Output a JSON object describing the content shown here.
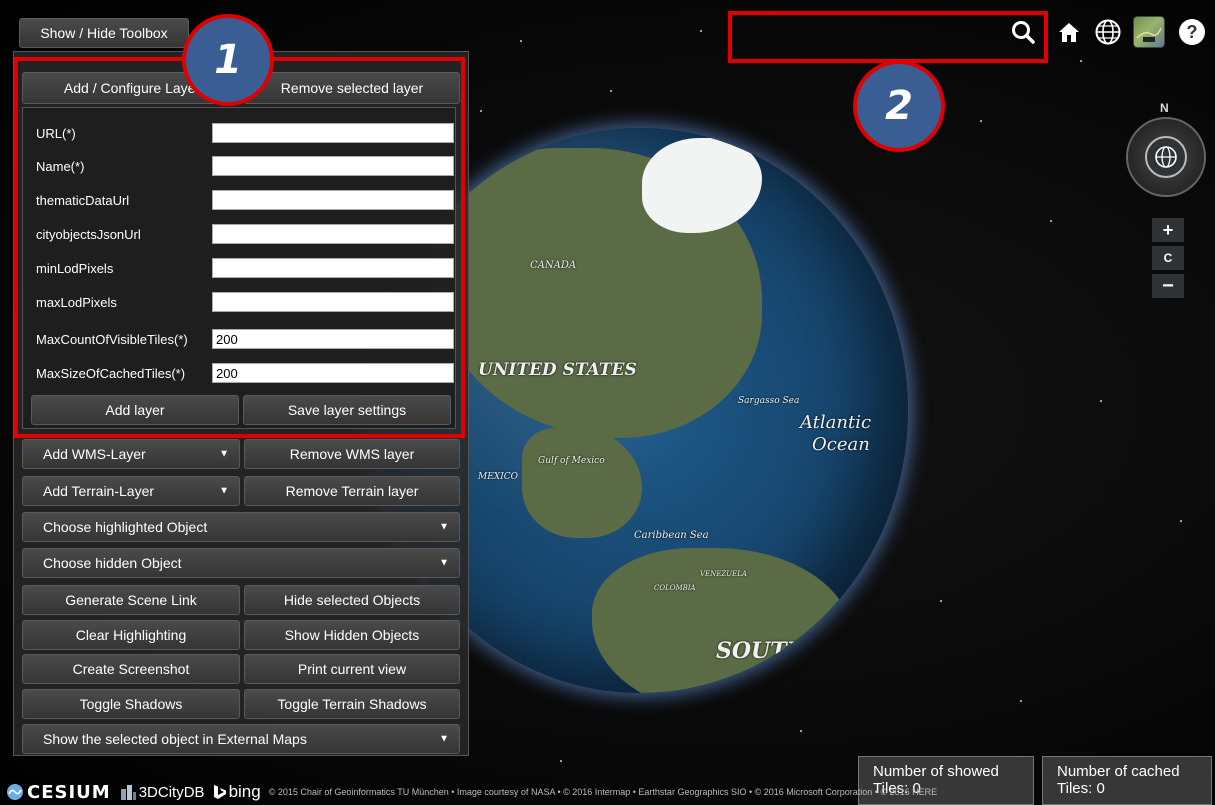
{
  "toolbox": {
    "toggle_label": "Show / Hide Toolbox",
    "add_configure_label": "Add / Configure Layer",
    "remove_selected_label": "Remove selected layer",
    "form": {
      "url_label": "URL(*)",
      "url_value": "",
      "name_label": "Name(*)",
      "name_value": "",
      "thematic_label": "thematicDataUrl",
      "thematic_value": "",
      "cityobjects_label": "cityobjectsJsonUrl",
      "cityobjects_value": "",
      "minlod_label": "minLodPixels",
      "minlod_value": "",
      "maxlod_label": "maxLodPixels",
      "maxlod_value": "",
      "maxcount_label": "MaxCountOfVisibleTiles(*)",
      "maxcount_value": "200",
      "maxsize_label": "MaxSizeOfCachedTiles(*)",
      "maxsize_value": "200",
      "add_layer_label": "Add layer",
      "save_settings_label": "Save layer settings"
    },
    "add_wms_label": "Add WMS-Layer",
    "remove_wms_label": "Remove WMS layer",
    "add_terrain_label": "Add Terrain-Layer",
    "remove_terrain_label": "Remove Terrain layer",
    "choose_highlighted_label": "Choose highlighted Object",
    "choose_hidden_label": "Choose hidden Object",
    "generate_link_label": "Generate Scene Link",
    "hide_selected_label": "Hide selected Objects",
    "clear_highlighting_label": "Clear Highlighting",
    "show_hidden_label": "Show Hidden Objects",
    "create_screenshot_label": "Create Screenshot",
    "print_view_label": "Print current view",
    "toggle_shadows_label": "Toggle Shadows",
    "toggle_terrain_shadows_label": "Toggle Terrain Shadows",
    "external_maps_label": "Show the selected object in External Maps"
  },
  "annotations": {
    "badge_1": "1",
    "badge_2": "2"
  },
  "search": {
    "value": ""
  },
  "navigation": {
    "compass_letter": "N",
    "zoom_in": "+",
    "reset": "C",
    "zoom_out": "−"
  },
  "globe_labels": {
    "canada": "CANADA",
    "united_states": "UNITED STATES",
    "atlantic": "Atlantic",
    "ocean": "Ocean",
    "sargasso": "Sargasso Sea",
    "gulf": "Gulf of Mexico",
    "mexico": "MEXICO",
    "caribbean": "Caribbean Sea",
    "venezuela": "VENEZUELA",
    "colombia": "COLOMBIA",
    "south": "SOUTH"
  },
  "status": {
    "showed_label": "Number of showed",
    "showed_value": "Tiles: 0",
    "cached_label": "Number of cached",
    "cached_value": "Tiles: 0"
  },
  "footer": {
    "cesium": "CESIUM",
    "citydb": "3DCityDB",
    "bing": "bing",
    "credits": "© 2015 Chair of Geoinformatics TU München • Image courtesy of NASA • © 2016 Intermap • Earthstar Geographics SIO • © 2016 Microsoft Corporation • © 2016 HERE"
  },
  "colors": {
    "annotation_red": "#e00000",
    "badge_blue": "#3a5d94",
    "panel_dark": "#353535"
  }
}
